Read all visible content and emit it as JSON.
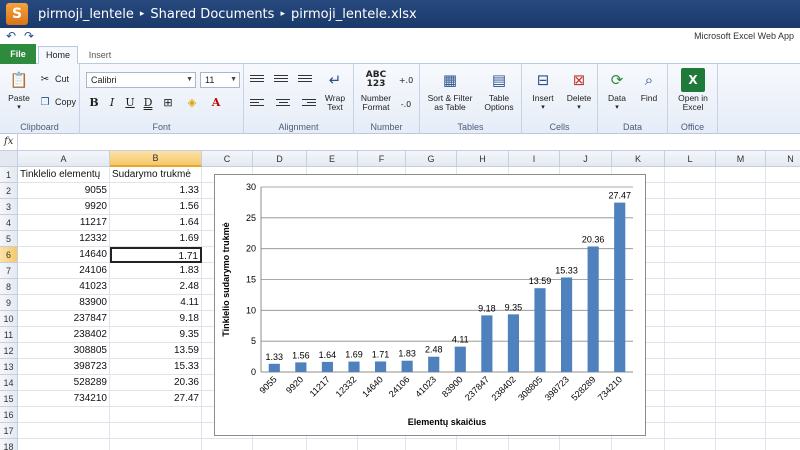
{
  "titlebar": {
    "logo_letter": "S",
    "breadcrumb": [
      "pirmoji_lentele",
      "Shared Documents",
      "pirmoji_lentele.xlsx"
    ],
    "separator": "▸"
  },
  "app_name": "Microsoft Excel Web App",
  "tabs": [
    {
      "label": "File"
    },
    {
      "label": "Home"
    },
    {
      "label": "Insert"
    }
  ],
  "ribbon": {
    "clipboard": {
      "paste": "Paste",
      "cut": "Cut",
      "copy": "Copy",
      "label": "Clipboard"
    },
    "font": {
      "name": "Calibri",
      "size": "11",
      "label": "Font"
    },
    "alignment": {
      "wrap": "Wrap Text",
      "label": "Alignment"
    },
    "number": {
      "format": "Number Format",
      "icon_text": "ABC 123",
      "label": "Number"
    },
    "tables": {
      "sort": "Sort & Filter as Table",
      "options": "Table Options",
      "label": "Tables"
    },
    "cells": {
      "insert": "Insert",
      "delete": "Delete",
      "label": "Cells"
    },
    "data": {
      "data": "Data",
      "find": "Find",
      "label": "Data"
    },
    "office": {
      "open": "Open in Excel",
      "label": "Office"
    }
  },
  "formula_bar": {
    "fx": "fx",
    "value": ""
  },
  "grid": {
    "columns": [
      "A",
      "B",
      "C",
      "D",
      "E",
      "F",
      "G",
      "H",
      "I",
      "J",
      "K",
      "L",
      "M",
      "N"
    ],
    "selected_column": "B",
    "selected_row": 6,
    "rows": [
      1,
      2,
      3,
      4,
      5,
      6,
      7,
      8,
      9,
      10,
      11,
      12,
      13,
      14,
      15,
      16,
      17,
      18
    ],
    "headers": [
      "Tinklelio elementų",
      "Sudarymo trukmė"
    ],
    "data": [
      [
        "9055",
        "1.33"
      ],
      [
        "9920",
        "1.56"
      ],
      [
        "11217",
        "1.64"
      ],
      [
        "12332",
        "1.69"
      ],
      [
        "14640",
        "1.71"
      ],
      [
        "24106",
        "1.83"
      ],
      [
        "41023",
        "2.48"
      ],
      [
        "83900",
        "4.11"
      ],
      [
        "237847",
        "9.18"
      ],
      [
        "238402",
        "9.35"
      ],
      [
        "308805",
        "13.59"
      ],
      [
        "398723",
        "15.33"
      ],
      [
        "528289",
        "20.36"
      ],
      [
        "734210",
        "27.47"
      ]
    ]
  },
  "chart_data": {
    "type": "bar",
    "title": "",
    "xlabel": "Elementų skaičius",
    "ylabel": "Tinklelio sudarymo trukmė",
    "categories": [
      "9055",
      "9920",
      "11217",
      "12332",
      "14640",
      "24106",
      "41023",
      "83900",
      "237847",
      "238402",
      "308805",
      "398723",
      "528289",
      "734210"
    ],
    "values": [
      1.33,
      1.56,
      1.64,
      1.69,
      1.71,
      1.83,
      2.48,
      4.11,
      9.18,
      9.35,
      13.59,
      15.33,
      20.36,
      27.47
    ],
    "ylim": [
      0,
      30
    ],
    "yticks": [
      0,
      5,
      10,
      15,
      20,
      25,
      30
    ],
    "grid": true,
    "bar_color": "#4f81bd"
  },
  "colors": {
    "titlebar": "#1e3f72",
    "file_tab": "#2e8a3c",
    "selection": "#f6c869"
  }
}
